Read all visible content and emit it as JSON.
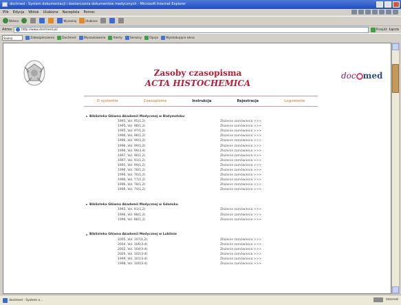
{
  "window": {
    "title": "doctmed - System dokumentacji i dostarczania dokumentów medycznych - Microsoft Internet Explorer"
  },
  "menu": [
    "Plik",
    "Edycja",
    "Widok",
    "Ulubione",
    "Narzędzia",
    "Pomoc"
  ],
  "toolbar": {
    "back": "Wstecz",
    "forward": "",
    "search": "Wyszukaj",
    "favorites": "Ulubione"
  },
  "address": {
    "label": "Adres",
    "value": "http://www.doctmed.pl/",
    "go": "Przejdź",
    "links": "Łącza"
  },
  "linksbar": {
    "field": "Szukaj",
    "items": [
      "Zabezpieczenia",
      "Doctmed",
      "Wyszukiwanie",
      "Alerty",
      "Serwisy",
      "Opcje",
      "Wyskakujące okna"
    ]
  },
  "page": {
    "title1": "Zasoby czasopisma",
    "title2": "ACTA HISTOCHEMICA",
    "logo": {
      "doc": "doc",
      "med": "med"
    },
    "nav": [
      "O systemie",
      "Czasopisma",
      "Instrukcja",
      "Rejestracja",
      "Logowanie"
    ],
    "libraries": [
      {
        "name": "Biblioteka Główna Akademii Medycznej w Białymstoku",
        "volumes": [
          "1993, Vol. 95(1,2)",
          "1995, Vol. 98(1,2)",
          "1995, Vol. 97(1,2)",
          "1996, Vol. 98(1,2)",
          "1996, Vol. 99(1,2)",
          "1996, Vol. 99(1,2)",
          "1996, Vol. 99(3,4)",
          "1997, Vol. 90(1,2)",
          "1997, Vol. 91(1,2)",
          "1995, Vol. 99(1,2)",
          "1996, Vol. 78(1,2)",
          "1996, Vol. 76(1,2)",
          "1996, Vol. 77(1,2)",
          "1996, Vol. 78(1,2)",
          "1996, Vol. 74(1,2)"
        ],
        "link_label": "Złożenie zamówienia >>>"
      },
      {
        "name": "Biblioteka Główna Akademii Medycznej w Gdańsku",
        "volumes": [
          "1993, Vol. 91(1,2)",
          "1996, Vol. 88(1,2)",
          "1996, Vol. 88(1,2)"
        ],
        "link_label": "Złożenie zamówienia >>>"
      },
      {
        "name": "Biblioteka Główna Akademii Medycznej w Lublinie",
        "volumes": [
          "2005, Vol. 107(1,2)",
          "2004, Vol. 106(3-4)",
          "2002, Vol. 104(3-4)",
          "2000, Vol. 102(3-4)",
          "1999, Vol. 101(3-4)",
          "1998, Vol. 100(3-4)"
        ],
        "link_label": "Złożenie zamówienia >>>"
      }
    ]
  },
  "status": {
    "text": "doctmed - System o...",
    "zone": "Internet"
  },
  "colors": {
    "title": "#b3213a",
    "nav_inactive": "#e0a26c",
    "nav_active": "#2a2a3a",
    "titlebar": "#2a5acb"
  }
}
